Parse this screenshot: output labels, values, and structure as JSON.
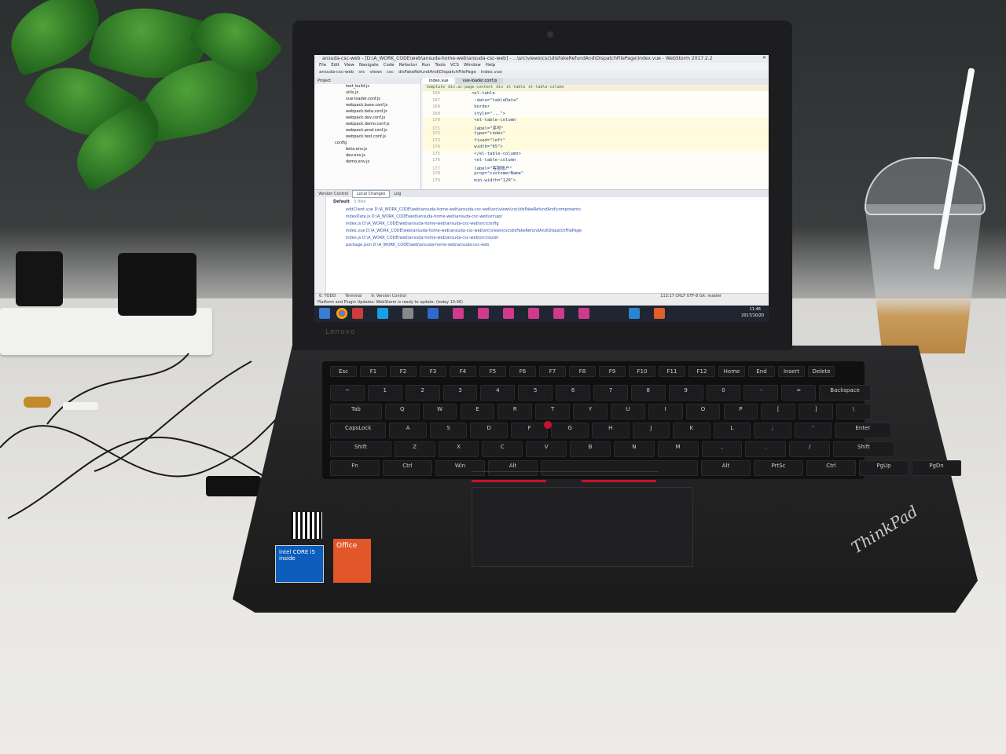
{
  "ide": {
    "window_title": "ansuda-csc-web - [D:\\A_WORK_CODE\\web\\ansuda-home-web\\ansuda-csc-web] - ...\\src\\views\\csc\\disFakeRefundAnd\\DispatchFilePage\\index.vue - WebStorm 2017.2.2",
    "menu": [
      "File",
      "Edit",
      "View",
      "Navigate",
      "Code",
      "Refactor",
      "Run",
      "Tools",
      "VCS",
      "Window",
      "Help"
    ],
    "breadcrumb": [
      "ansuda-csc-web",
      "src",
      "views",
      "csc",
      "disFakeRefundAnd\\DispatchFilePage",
      "index.vue"
    ],
    "project_label": "Project",
    "project_files": [
      "test_build.js",
      "utils.js",
      "vue-loader.conf.js",
      "webpack.base.conf.js",
      "webpack.beta.conf.js",
      "webpack.dev.conf.js",
      "webpack.demo.conf.js",
      "webpack.prod.conf.js",
      "webpack.test.conf.js",
      "config",
      "beta.env.js",
      "dev.env.js",
      "demo.env.js"
    ],
    "editor_tabs": [
      "index.vue",
      "vue-loader.conf.js"
    ],
    "editor_breadcrumb": [
      "template",
      "div.ac-page-content",
      "div",
      "el-table",
      "el-table-column"
    ],
    "line_numbers": [
      "166",
      "167",
      "168",
      "169",
      "170",
      "171",
      "172",
      "173",
      "174",
      "175",
      "176",
      "177",
      "178",
      "179"
    ],
    "code_lines": [
      "<el-table",
      "  :data=\"tableData\"",
      "  border",
      "  style=\"...\">",
      "  <el-table-column",
      "    label=\"序号\"",
      "    type=\"index\"",
      "    fixed=\"left\"",
      "    width=\"65\">",
      "  </el-table-column>",
      "  <el-table-column",
      "    label=\"客服账户\"",
      "    prop=\"customerName\"",
      "    min-width=\"120\">"
    ],
    "vcs_tabs": [
      "Version Control",
      "Local Changes",
      "Log"
    ],
    "changelist": "Default",
    "changelist_count": "5 files",
    "changed_files": [
      "editClient.vue  D:\\A_WORK_CODE\\web\\ansuda-home-web\\ansuda-csc-web\\src\\views\\csc\\disFakeRefundAnd\\components",
      "indexData.js  D:\\A_WORK_CODE\\web\\ansuda-home-web\\ansuda-csc-web\\src\\api",
      "index.js  D:\\A_WORK_CODE\\web\\ansuda-home-web\\ansuda-csc-web\\src\\config",
      "index.vue  D:\\A_WORK_CODE\\web\\ansuda-home-web\\ansuda-csc-web\\src\\views\\csc\\disFakeRefundAnd\\DispatchFilePage",
      "index.js  D:\\A_WORK_CODE\\web\\ansuda-home-web\\ansuda-csc-web\\src\\router",
      "package.json  D:\\A_WORK_CODE\\web\\ansuda-home-web\\ansuda-csc-web"
    ],
    "bottom_tabs": [
      "6: TODO",
      "Terminal",
      "9: Version Control"
    ],
    "status_message": "Platform and Plugin Updates: WebStorm is ready to update. (today 10:06)",
    "status_right": "113:17  CRLF  UTF-8  Git: master",
    "clock_time": "11:46",
    "clock_date": "2017/10/20"
  },
  "laptop": {
    "brand_lid": "Lenovo",
    "brand_palmrest": "ThinkPad",
    "sticker_intel": "intel CORE i5 inside",
    "sticker_office": "Office"
  },
  "keyboard_rows": [
    [
      "Esc",
      "F1",
      "F2",
      "F3",
      "F4",
      "F5",
      "F6",
      "F7",
      "F8",
      "F9",
      "F10",
      "F11",
      "F12",
      "Home",
      "End",
      "Insert",
      "Delete"
    ],
    [
      "~",
      "1",
      "2",
      "3",
      "4",
      "5",
      "6",
      "7",
      "8",
      "9",
      "0",
      "-",
      "=",
      "Backspace"
    ],
    [
      "Tab",
      "Q",
      "W",
      "E",
      "R",
      "T",
      "Y",
      "U",
      "I",
      "O",
      "P",
      "[",
      "]",
      "\\"
    ],
    [
      "CapsLock",
      "A",
      "S",
      "D",
      "F",
      "G",
      "H",
      "J",
      "K",
      "L",
      ";",
      "'",
      "Enter"
    ],
    [
      "Shift",
      "Z",
      "X",
      "C",
      "V",
      "B",
      "N",
      "M",
      ",",
      ".",
      "/",
      "Shift"
    ],
    [
      "Fn",
      "Ctrl",
      "Win",
      "Alt",
      "",
      "Alt",
      "PrtSc",
      "Ctrl",
      "PgUp",
      "PgDn"
    ]
  ],
  "colors": {
    "trackpoint": "#c8102e",
    "taskbar": "#1f2631",
    "desk": "#e6e5e1",
    "laptop": "#1d1d1f"
  }
}
